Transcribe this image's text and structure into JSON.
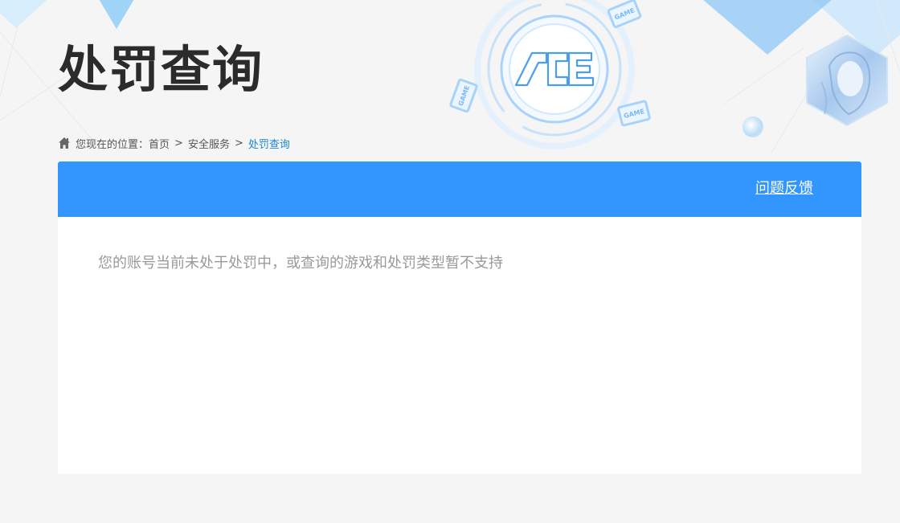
{
  "header": {
    "title": "处罚查询",
    "logo_text": "ACE",
    "game_badge": "GAME"
  },
  "breadcrumb": {
    "prefix": "您现在的位置：",
    "items": [
      {
        "label": "首页"
      },
      {
        "label": "安全服务"
      },
      {
        "label": "处罚查询"
      }
    ],
    "separator": ">"
  },
  "panel": {
    "feedback_label": "问题反馈",
    "message": "您的账号当前未处于处罚中，或查询的游戏和处罚类型暂不支持"
  },
  "colors": {
    "accent": "#3396fe",
    "breadcrumb_current": "#1a86d6",
    "page_bg": "#f5f5f5"
  },
  "icons": {
    "home": "home-icon"
  }
}
